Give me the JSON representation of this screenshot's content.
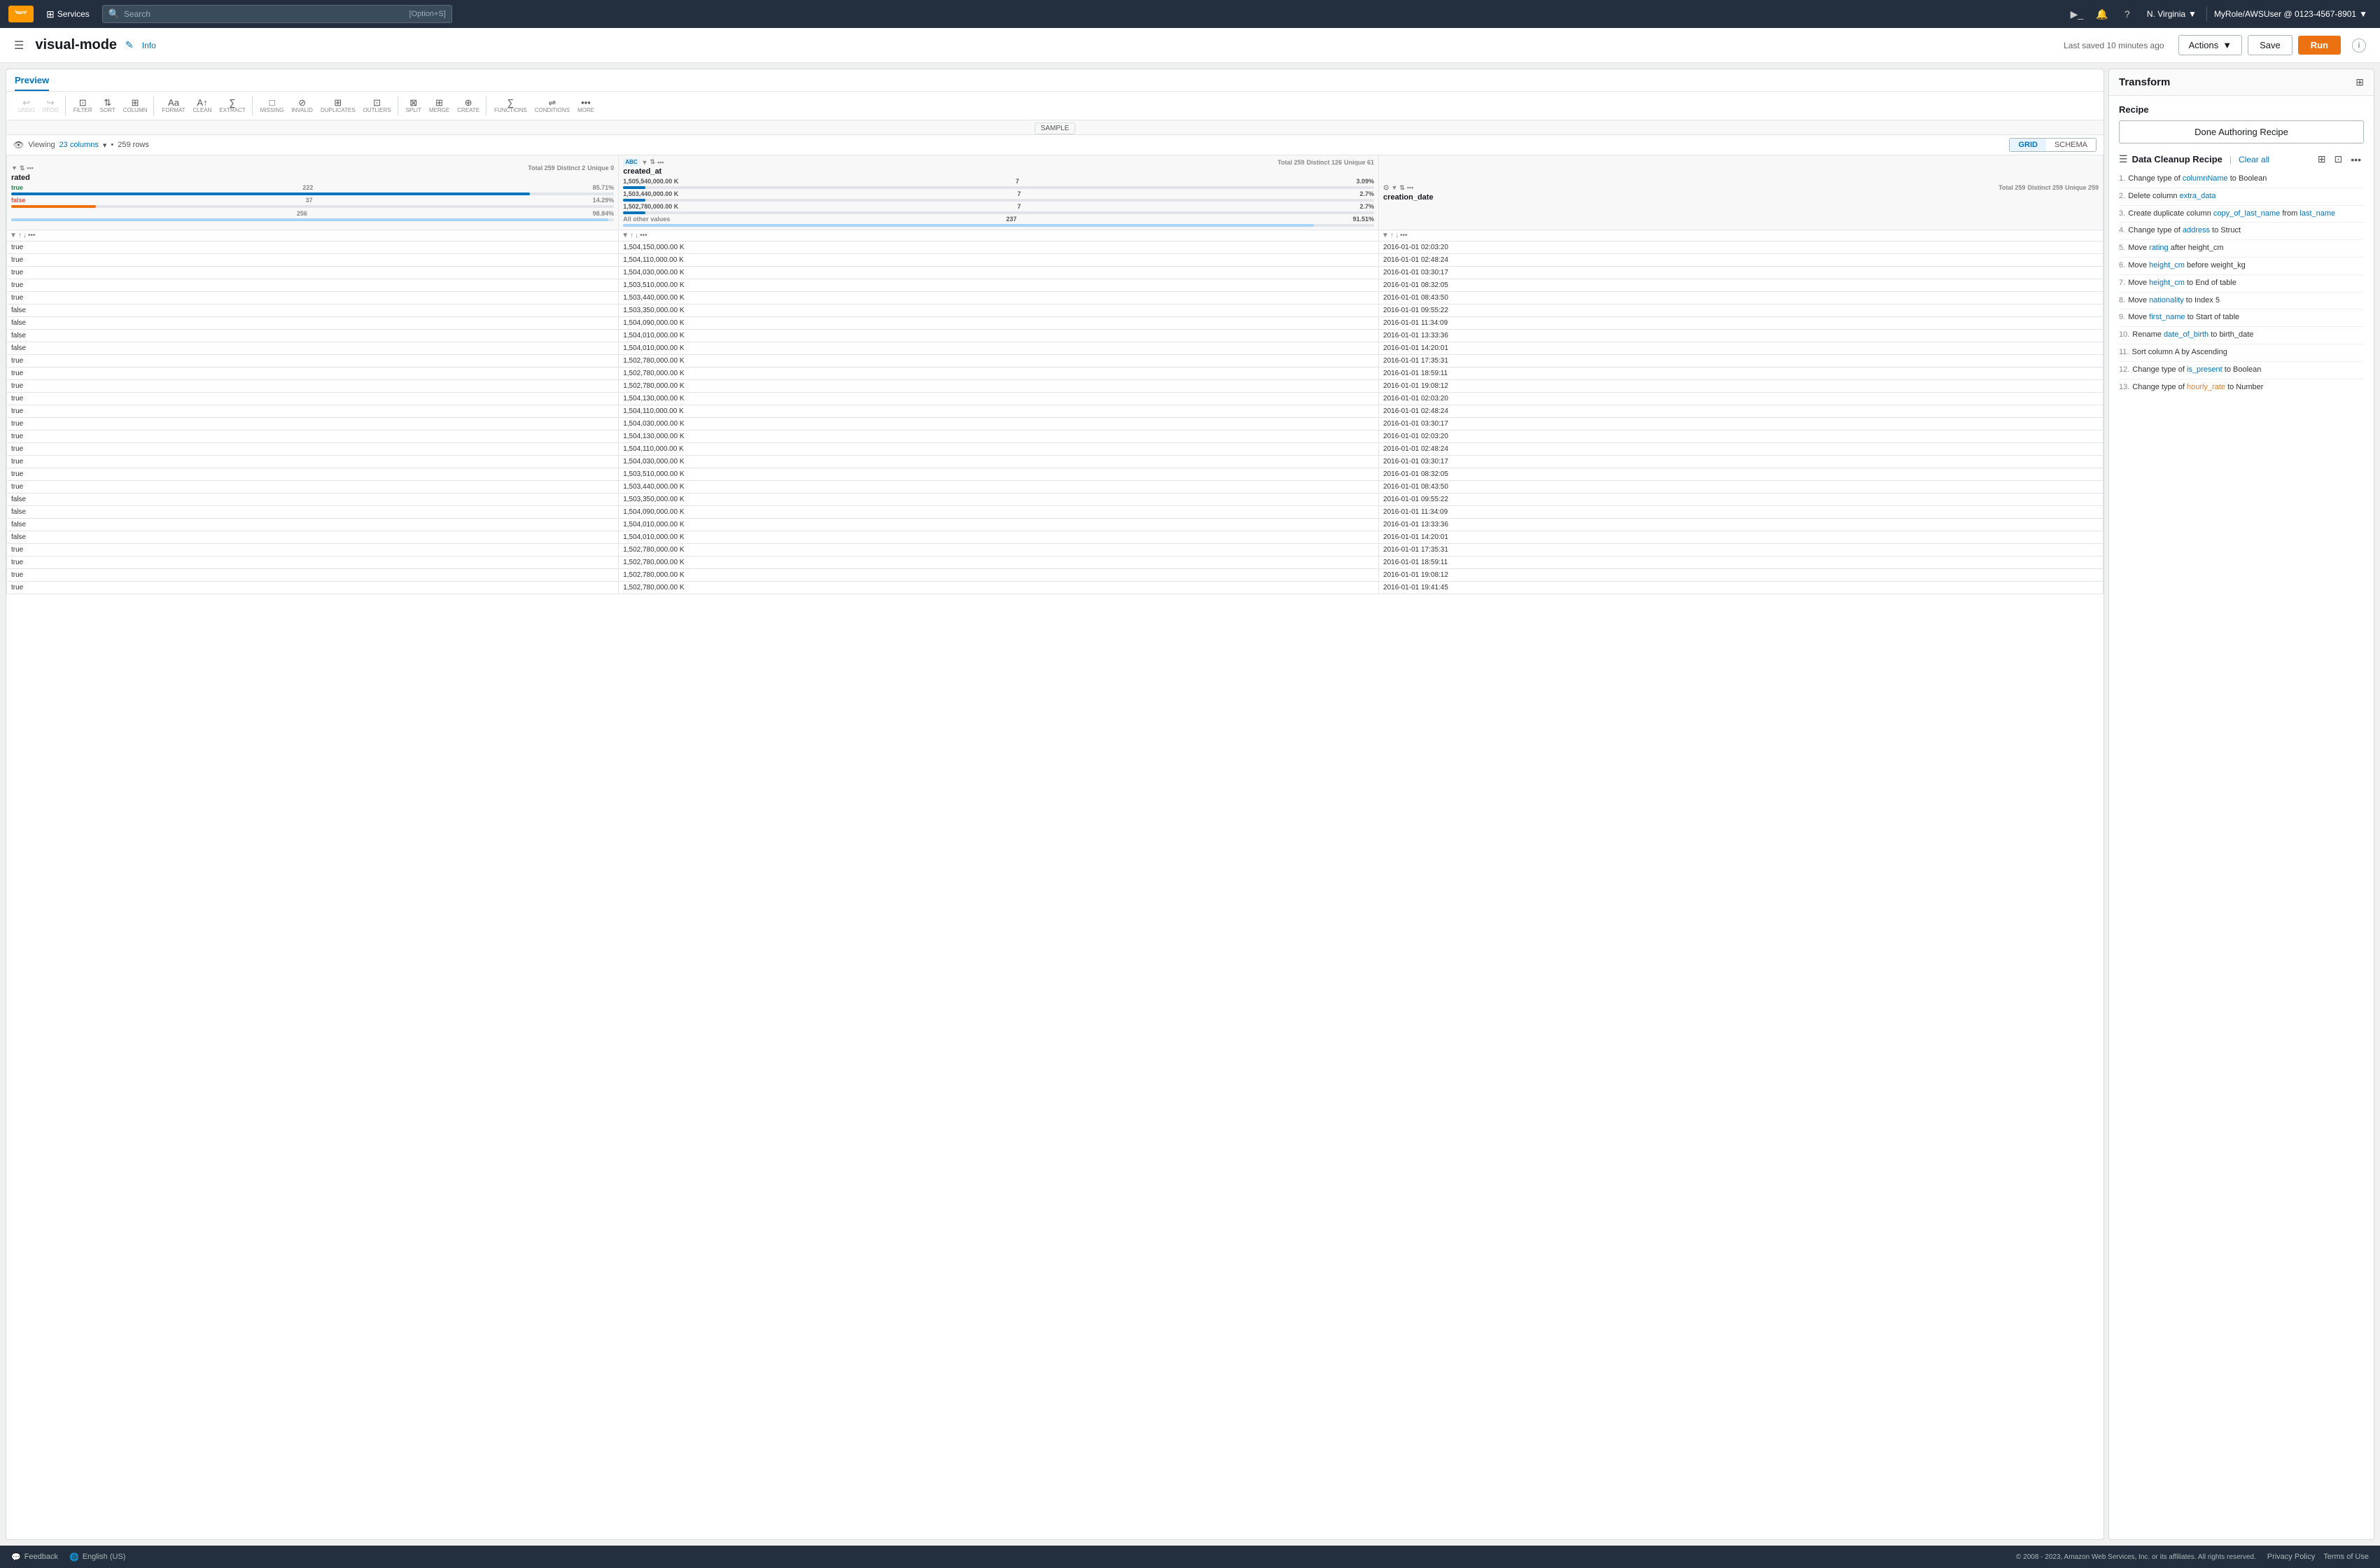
{
  "topnav": {
    "logo": "aws",
    "services_label": "Services",
    "search_placeholder": "Search",
    "search_shortcut": "[Option+S]",
    "region": "N. Virginia",
    "region_chevron": "▼",
    "user": "MyRole/AWSUser @ 0123-4567-8901",
    "user_chevron": "▼"
  },
  "header": {
    "title": "visual-mode",
    "info_label": "Info",
    "last_saved": "Last saved 10 minutes ago",
    "actions_label": "Actions",
    "actions_chevron": "▼",
    "save_label": "Save",
    "run_label": "Run"
  },
  "toolbar": {
    "undo_label": "UNDO",
    "redo_label": "REDO",
    "filter_label": "FILTER",
    "sort_label": "SORT",
    "column_label": "COLUMN",
    "format_label": "FORMAT",
    "clean_label": "CLEAN",
    "extract_label": "EXTRACT",
    "missing_label": "MISSING",
    "invalid_label": "INVALID",
    "duplicates_label": "DUPLICATES",
    "outliers_label": "OUTLIERS",
    "split_label": "SPLIT",
    "merge_label": "MERGE",
    "create_label": "CREATE",
    "functions_label": "FUNCTIONS",
    "conditions_label": "CONDITIONS",
    "more_label": "MORE",
    "sample_label": "SAMPLE"
  },
  "preview": {
    "tab_label": "Preview",
    "viewing_prefix": "Viewing",
    "columns_label": "23 columns",
    "rows_label": "259 rows",
    "grid_label": "GRID",
    "schema_label": "SCHEMA"
  },
  "columns": {
    "rated": {
      "name": "rated",
      "type": "",
      "total": 259,
      "distinct": 2,
      "unique": 0,
      "stats": [
        {
          "value": "true",
          "count": 222,
          "pct": "85.71%",
          "bar": 85
        },
        {
          "value": "false",
          "count": 37,
          "pct": "14.29%",
          "bar": 14
        },
        {
          "value": "",
          "count": 256,
          "pct": "98.84%",
          "bar": 98
        }
      ]
    },
    "created_at": {
      "name": "created_at",
      "type": "ABC",
      "total": 259,
      "distinct": 126,
      "unique": 61,
      "values": [
        "1,505,540,000.00 K",
        "1,503,440,000.00 K",
        "1,502,780,000.00 K"
      ]
    },
    "creation_date": {
      "name": "creation_date",
      "type": "⊙",
      "total": 259,
      "distinct": 259,
      "unique": 259
    }
  },
  "data_rows": [
    {
      "rated": "true",
      "created_at": "1,504,150,000.00 K",
      "creation_date": "2016-01-01 02:03:20"
    },
    {
      "rated": "true",
      "created_at": "1,504,110,000.00 K",
      "creation_date": "2016-01-01 02:48:24"
    },
    {
      "rated": "true",
      "created_at": "1,504,030,000.00 K",
      "creation_date": "2016-01-01 03:30:17"
    },
    {
      "rated": "true",
      "created_at": "1,503,510,000.00 K",
      "creation_date": "2016-01-01 08:32:05"
    },
    {
      "rated": "true",
      "created_at": "1,503,440,000.00 K",
      "creation_date": "2016-01-01 08:43:50"
    },
    {
      "rated": "false",
      "created_at": "1,503,350,000.00 K",
      "creation_date": "2016-01-01 09:55:22"
    },
    {
      "rated": "false",
      "created_at": "1,504,090,000.00 K",
      "creation_date": "2016-01-01 11:34:09"
    },
    {
      "rated": "false",
      "created_at": "1,504,010,000.00 K",
      "creation_date": "2016-01-01 13:33:36"
    },
    {
      "rated": "false",
      "created_at": "1,504,010,000.00 K",
      "creation_date": "2016-01-01 14:20:01"
    },
    {
      "rated": "true",
      "created_at": "1,502,780,000.00 K",
      "creation_date": "2016-01-01 17:35:31"
    },
    {
      "rated": "true",
      "created_at": "1,502,780,000.00 K",
      "creation_date": "2016-01-01 18:59:11"
    },
    {
      "rated": "true",
      "created_at": "1,502,780,000.00 K",
      "creation_date": "2016-01-01 19:08:12"
    },
    {
      "rated": "true",
      "created_at": "1,504,130,000.00 K",
      "creation_date": "2016-01-01 02:03:20"
    },
    {
      "rated": "true",
      "created_at": "1,504,110,000.00 K",
      "creation_date": "2016-01-01 02:48:24"
    },
    {
      "rated": "true",
      "created_at": "1,504,030,000.00 K",
      "creation_date": "2016-01-01 03:30:17"
    },
    {
      "rated": "true",
      "created_at": "1,504,130,000.00 K",
      "creation_date": "2016-01-01 02:03:20"
    },
    {
      "rated": "true",
      "created_at": "1,504,110,000.00 K",
      "creation_date": "2016-01-01 02:48:24"
    },
    {
      "rated": "true",
      "created_at": "1,504,030,000.00 K",
      "creation_date": "2016-01-01 03:30:17"
    },
    {
      "rated": "true",
      "created_at": "1,503,510,000.00 K",
      "creation_date": "2016-01-01 08:32:05"
    },
    {
      "rated": "true",
      "created_at": "1,503,440,000.00 K",
      "creation_date": "2016-01-01 08:43:50"
    },
    {
      "rated": "false",
      "created_at": "1,503,350,000.00 K",
      "creation_date": "2016-01-01 09:55:22"
    },
    {
      "rated": "false",
      "created_at": "1,504,090,000.00 K",
      "creation_date": "2016-01-01 11:34:09"
    },
    {
      "rated": "false",
      "created_at": "1,504,010,000.00 K",
      "creation_date": "2016-01-01 13:33:36"
    },
    {
      "rated": "false",
      "created_at": "1,504,010,000.00 K",
      "creation_date": "2016-01-01 14:20:01"
    },
    {
      "rated": "true",
      "created_at": "1,502,780,000.00 K",
      "creation_date": "2016-01-01 17:35:31"
    },
    {
      "rated": "true",
      "created_at": "1,502,780,000.00 K",
      "creation_date": "2016-01-01 18:59:11"
    },
    {
      "rated": "true",
      "created_at": "1,502,780,000.00 K",
      "creation_date": "2016-01-01 19:08:12"
    },
    {
      "rated": "true",
      "created_at": "1,502,780,000.00 K",
      "creation_date": "2016-01-01 19:41:45"
    }
  ],
  "transform": {
    "panel_title": "Transform",
    "recipe_label": "Recipe",
    "done_authoring_label": "Done Authoring Recipe",
    "cleanup_title": "Data Cleanup Recipe",
    "clear_all_label": "Clear all",
    "steps": [
      {
        "num": 1,
        "text": "Change type of ",
        "highlight": "columnName",
        "suffix": " to Boolean"
      },
      {
        "num": 2,
        "text": "Delete column ",
        "highlight": "extra_data",
        "suffix": ""
      },
      {
        "num": 3,
        "text": "Create duplicate column ",
        "highlight": "copy_of_last_name",
        "mid": " from ",
        "highlight2": "last_name",
        "suffix": ""
      },
      {
        "num": 4,
        "text": "Change type of ",
        "highlight": "address",
        "suffix": " to Struct"
      },
      {
        "num": 5,
        "text": "Move ",
        "highlight": "rating",
        "suffix": " after height_cm"
      },
      {
        "num": 6,
        "text": "Move ",
        "highlight": "height_cm",
        "suffix": " before weight_kg"
      },
      {
        "num": 7,
        "text": "Move ",
        "highlight": "height_cm",
        "suffix": " to End of table"
      },
      {
        "num": 8,
        "text": "Move ",
        "highlight": "nationality",
        "suffix": " to Index 5"
      },
      {
        "num": 9,
        "text": "Move ",
        "highlight": "first_name",
        "suffix": " to Start of table"
      },
      {
        "num": 10,
        "text": "Rename ",
        "highlight": "date_of_birth",
        "suffix": " to birth_date"
      },
      {
        "num": 11,
        "text": "Sort column A by Ascending",
        "highlight": "",
        "suffix": ""
      },
      {
        "num": 12,
        "text": "Change type of ",
        "highlight": "is_present",
        "suffix": " to Boolean"
      },
      {
        "num": 13,
        "text": "Change type of ",
        "highlight": "hourly_rate",
        "suffix": " to Number"
      }
    ]
  },
  "footer": {
    "feedback_label": "Feedback",
    "locale_label": "English (US)",
    "copyright": "© 2008 - 2023, Amazon Web Services, Inc. or its affiliates. All rights reserved.",
    "privacy_label": "Privacy Policy",
    "terms_label": "Terms of Use"
  }
}
